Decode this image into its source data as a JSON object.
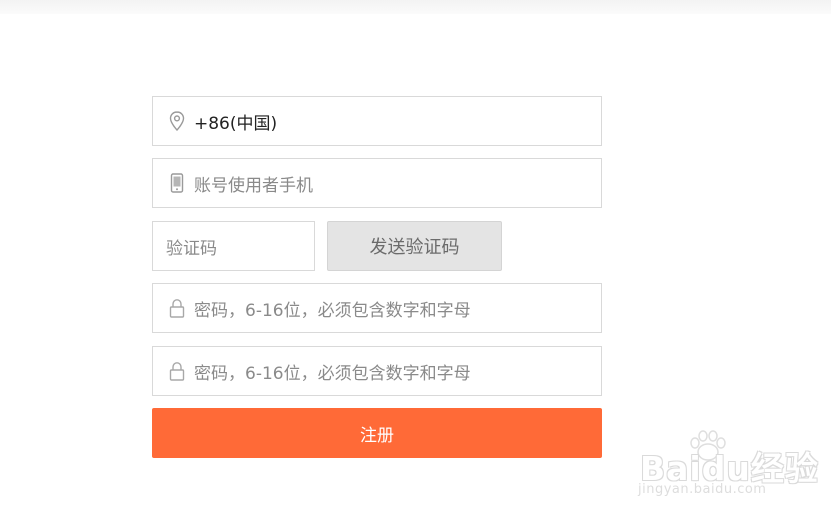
{
  "form": {
    "country_value": "+86(中国)",
    "phone_placeholder": "账号使用者手机",
    "code_placeholder": "验证码",
    "send_code_label": "发送验证码",
    "password_placeholder": "密码，6-16位，必须包含数字和字母",
    "confirm_password_placeholder": "密码，6-16位，必须包含数字和字母",
    "register_label": "注册"
  },
  "watermark": {
    "brand": "Baidu经验",
    "url": "jingyan.baidu.com"
  },
  "icons": {
    "country": "location-pin-icon",
    "phone": "mobile-phone-icon",
    "password": "lock-icon",
    "confirm_password": "lock-icon",
    "watermark": "paw-icon"
  },
  "colors": {
    "register_button": "#ff6a37",
    "send_code_button": "#e4e4e4",
    "field_border": "#d9d9d9"
  }
}
